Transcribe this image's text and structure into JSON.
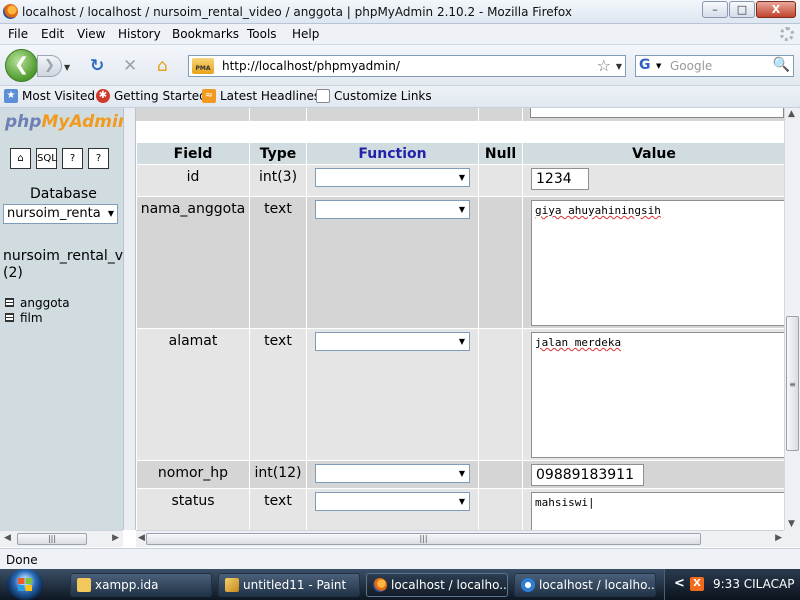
{
  "window": {
    "title": "localhost / localhost / nursoim_rental_video / anggota | phpMyAdmin 2.10.2 - Mozilla Firefox",
    "minimize": "–",
    "maximize": "□",
    "close": "X"
  },
  "menu": [
    "File",
    "Edit",
    "View",
    "History",
    "Bookmarks",
    "Tools",
    "Help"
  ],
  "nav": {
    "url": "http://localhost/phpmyadmin/",
    "search_placeholder": "Google",
    "favicon_text": "PMA"
  },
  "bookmarks": [
    "Most Visited",
    "Getting Started",
    "Latest Headlines",
    "Customize Links"
  ],
  "sidebar": {
    "logo_php": "php",
    "logo_myadmin": "MyAdmin",
    "icon_labels": [
      "⌂",
      "SQL",
      "?",
      "?"
    ],
    "database_label": "Database",
    "database_select": "nursoim_renta",
    "db_name": "nursoim_rental_vid",
    "db_count": "(2)",
    "tables": [
      "anggota",
      "film"
    ]
  },
  "table": {
    "headers": {
      "field": "Field",
      "type": "Type",
      "function": "Function",
      "null": "Null",
      "value": "Value"
    },
    "rows": [
      {
        "field": "id",
        "type": "int(3)",
        "value": "1234",
        "kind": "input"
      },
      {
        "field": "nama_anggota",
        "type": "text",
        "value": "giya ahuyahiningsih",
        "kind": "textarea"
      },
      {
        "field": "alamat",
        "type": "text",
        "value": "jalan merdeka",
        "kind": "textarea"
      },
      {
        "field": "nomor_hp",
        "type": "int(12)",
        "value": "09889183911",
        "kind": "input"
      },
      {
        "field": "status",
        "type": "text",
        "value": "mahsiswi",
        "kind": "textarea"
      }
    ]
  },
  "statusbar": {
    "text": "Done"
  },
  "taskbar": {
    "tasks": [
      {
        "label": "xampp.ida",
        "active": false
      },
      {
        "label": "untitled11 - Paint",
        "active": false
      },
      {
        "label": "localhost / localho...",
        "active": true
      },
      {
        "label": "localhost / localho...",
        "active": false
      }
    ],
    "tray_chevron": "<",
    "tray_xampp": "X",
    "clock": "9:33 CILACAP"
  }
}
